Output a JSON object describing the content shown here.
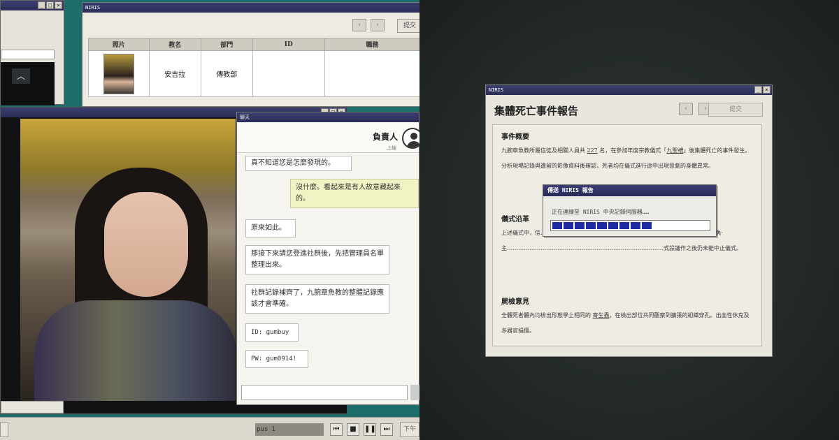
{
  "niris_table_window": {
    "title": "NIRIS",
    "submit_label": "提交",
    "prev": "‹",
    "next": "›",
    "columns": [
      "照片",
      "教名",
      "部門",
      "ID",
      "職務"
    ],
    "rows": [
      {
        "name": "安吉拉",
        "dept": "傳教部",
        "id": "",
        "role": ""
      }
    ]
  },
  "chat": {
    "title": "聊天",
    "contact_name": "負責人",
    "contact_status": "上線",
    "messages": [
      {
        "from": "them",
        "text": "真不知道您是怎麼發現的。"
      },
      {
        "from": "me",
        "text": "沒什麼。看起來是有人故意藏起來的。"
      },
      {
        "from": "them",
        "text": "原來如此。"
      },
      {
        "from": "them",
        "text": "那接下來請您登進社群後，先把管理員名單整理出來。"
      },
      {
        "from": "them",
        "text": "社群記錄補齊了，九腕章魚教的整體記錄應該才會準確。"
      },
      {
        "from": "them",
        "text": "ID: gumbuy"
      },
      {
        "from": "them",
        "text": "PW: gum0914!"
      }
    ]
  },
  "media_bar": {
    "track_label": "pus 1",
    "next_label": "下午"
  },
  "report": {
    "window_title": "NIRIS",
    "title": "集體死亡事件報告",
    "submit_label": "提交",
    "sections": [
      {
        "heading": "事件概要",
        "text_parts": [
          "九腕章魚教所屬信徒及相關人員共 ",
          "227",
          " 名，在參加年度宗教儀式「",
          "九聖禮",
          "」後集體死亡的事件發生。分析現場記錄與遺留的影像資料後確認，死者均在儀式進行途中出現意劇的身體異常。"
        ]
      },
      {
        "heading": "儀式沿革",
        "text": "上述儀式中，信…………………………………………………………………數團繪袖·腔骨魚·主…………………………………………………………………………式設議作之後仍未能中止儀式。"
      },
      {
        "heading": "屍檢意見",
        "text_parts": [
          "全體死者體內均檢出形態學上相同的 ",
          "寄生蟲",
          "，在檢出部位共同觀察到擴張的組織穿孔。出血性休克及多器官損傷。"
        ]
      }
    ]
  },
  "dialog": {
    "title": "傳送 NIRIS 報告",
    "message": "正在連線至 NIRIS 中央記錄伺服器……",
    "progress_blocks": 9,
    "progress_fraction": 0.62
  },
  "colors": {
    "titlebar": "#2b2d58",
    "progress": "#1d2aa0",
    "desktop_teal": "#1c6e6a"
  }
}
